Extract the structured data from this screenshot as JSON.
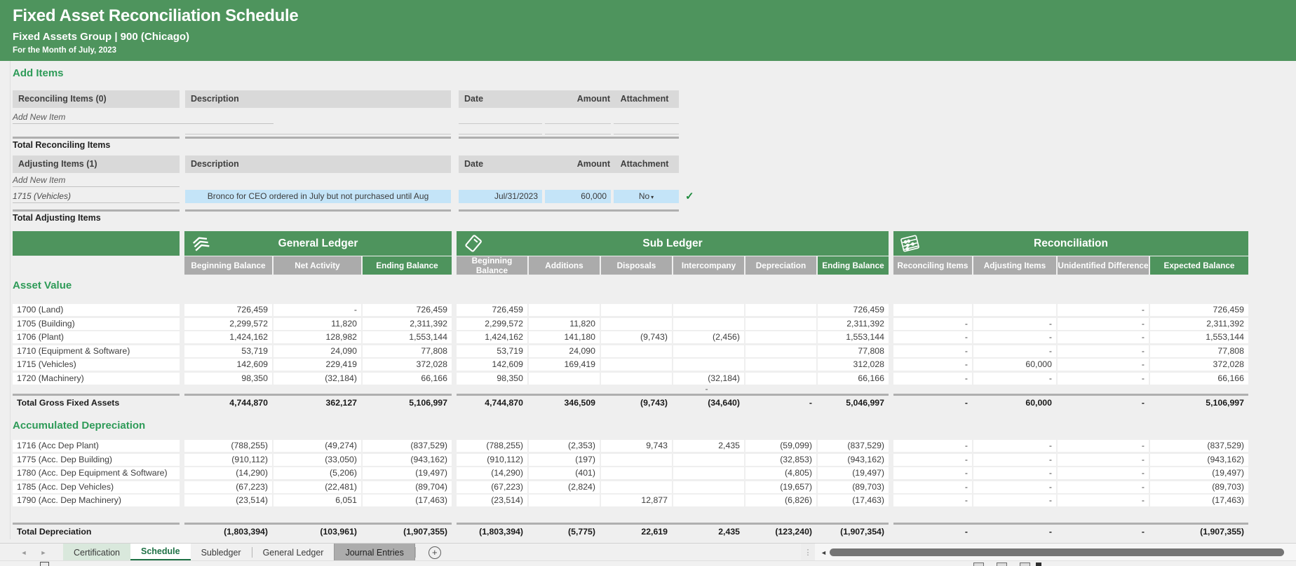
{
  "header": {
    "title": "Fixed Asset Reconciliation Schedule",
    "subtitle": "Fixed Assets Group  |  900 (Chicago)",
    "period": "For the Month of July, 2023"
  },
  "add_items": {
    "section_title": "Add Items",
    "reconciling": {
      "header": "Reconciling Items (0)",
      "description_header": "Description",
      "date_header": "Date",
      "amount_header": "Amount",
      "attachment_header": "Attachment",
      "add_new_label": "Add New Item",
      "total_label": "Total Reconciling Items",
      "rows": []
    },
    "adjusting": {
      "header": "Adjusting Items (1)",
      "description_header": "Description",
      "date_header": "Date",
      "amount_header": "Amount",
      "attachment_header": "Attachment",
      "add_new_label": "Add New Item",
      "total_label": "Total Adjusting Items",
      "rows": [
        {
          "account": "1715 (Vehicles)",
          "description": "Bronco for CEO ordered in July but not purchased until Aug",
          "date": "Jul/31/2023",
          "amount": "60,000",
          "attachment": "No",
          "validated": "✓"
        }
      ]
    }
  },
  "schedule": {
    "groups": [
      {
        "name": "General Ledger",
        "icon": "ledger-icon",
        "columns": [
          "Beginning Balance",
          "Net Activity",
          "Ending Balance"
        ]
      },
      {
        "name": "Sub Ledger",
        "icon": "subledger-icon",
        "columns": [
          "Beginning Balance",
          "Additions",
          "Disposals",
          "Intercompany",
          "Depreciation",
          "Ending Balance"
        ]
      },
      {
        "name": "Reconciliation",
        "icon": "reconciliation-icon",
        "columns": [
          "Reconciling Items",
          "Adjusting Items",
          "Unidentified Difference",
          "Expected Balance"
        ]
      }
    ],
    "asset_value": {
      "section_title": "Asset Value",
      "rows": [
        {
          "account": "1700 (Land)",
          "gl": [
            "726,459",
            "-",
            "726,459"
          ],
          "sl": [
            "726,459",
            "",
            "",
            "",
            "",
            "726,459"
          ],
          "rec": [
            "",
            "",
            "-",
            "726,459"
          ]
        },
        {
          "account": "1705 (Building)",
          "gl": [
            "2,299,572",
            "11,820",
            "2,311,392"
          ],
          "sl": [
            "2,299,572",
            "11,820",
            "",
            "",
            "",
            "2,311,392"
          ],
          "rec": [
            "-",
            "-",
            "-",
            "2,311,392"
          ]
        },
        {
          "account": "1706 (Plant)",
          "gl": [
            "1,424,162",
            "128,982",
            "1,553,144"
          ],
          "sl": [
            "1,424,162",
            "141,180",
            "(9,743)",
            "(2,456)",
            "",
            "1,553,144"
          ],
          "rec": [
            "-",
            "-",
            "-",
            "1,553,144"
          ]
        },
        {
          "account": "1710 (Equipment & Software)",
          "gl": [
            "53,719",
            "24,090",
            "77,808"
          ],
          "sl": [
            "53,719",
            "24,090",
            "",
            "",
            "",
            "77,808"
          ],
          "rec": [
            "-",
            "-",
            "-",
            "77,808"
          ]
        },
        {
          "account": "1715 (Vehicles)",
          "gl": [
            "142,609",
            "229,419",
            "372,028"
          ],
          "sl": [
            "142,609",
            "169,419",
            "",
            "",
            "",
            "312,028"
          ],
          "rec": [
            "-",
            "60,000",
            "-",
            "372,028"
          ]
        },
        {
          "account": "1720 (Machinery)",
          "gl": [
            "98,350",
            "(32,184)",
            "66,166"
          ],
          "sl": [
            "98,350",
            "",
            "",
            "(32,184)",
            "",
            "66,166"
          ],
          "rec": [
            "-",
            "-",
            "-",
            "66,166"
          ]
        }
      ],
      "spacer": {
        "sl": [
          "",
          "",
          "",
          "-",
          "",
          ""
        ]
      },
      "total": {
        "label": "Total Gross Fixed Assets",
        "gl": [
          "4,744,870",
          "362,127",
          "5,106,997"
        ],
        "sl": [
          "4,744,870",
          "346,509",
          "(9,743)",
          "(34,640)",
          "-",
          "5,046,997"
        ],
        "rec": [
          "-",
          "60,000",
          "-",
          "5,106,997"
        ]
      }
    },
    "accumulated_depreciation": {
      "section_title": "Accumulated Depreciation",
      "rows": [
        {
          "account": "1716 (Acc Dep Plant)",
          "gl": [
            "(788,255)",
            "(49,274)",
            "(837,529)"
          ],
          "sl": [
            "(788,255)",
            "(2,353)",
            "9,743",
            "2,435",
            "(59,099)",
            "(837,529)"
          ],
          "rec": [
            "-",
            "-",
            "-",
            "(837,529)"
          ]
        },
        {
          "account": "1775 (Acc. Dep Building)",
          "gl": [
            "(910,112)",
            "(33,050)",
            "(943,162)"
          ],
          "sl": [
            "(910,112)",
            "(197)",
            "",
            "",
            "(32,853)",
            "(943,162)"
          ],
          "rec": [
            "-",
            "-",
            "-",
            "(943,162)"
          ]
        },
        {
          "account": "1780 (Acc. Dep Equipment & Software)",
          "gl": [
            "(14,290)",
            "(5,206)",
            "(19,497)"
          ],
          "sl": [
            "(14,290)",
            "(401)",
            "",
            "",
            "(4,805)",
            "(19,497)"
          ],
          "rec": [
            "-",
            "-",
            "-",
            "(19,497)"
          ]
        },
        {
          "account": "1785 (Acc. Dep Vehicles)",
          "gl": [
            "(67,223)",
            "(22,481)",
            "(89,704)"
          ],
          "sl": [
            "(67,223)",
            "(2,824)",
            "",
            "",
            "(19,657)",
            "(89,703)"
          ],
          "rec": [
            "-",
            "-",
            "-",
            "(89,703)"
          ]
        },
        {
          "account": "1790 (Acc. Dep Machinery)",
          "gl": [
            "(23,514)",
            "6,051",
            "(17,463)"
          ],
          "sl": [
            "(23,514)",
            "",
            "12,877",
            "",
            "(6,826)",
            "(17,463)"
          ],
          "rec": [
            "-",
            "-",
            "-",
            "(17,463)"
          ]
        }
      ],
      "total": {
        "label": "Total Depreciation",
        "gl": [
          "(1,803,394)",
          "(103,961)",
          "(1,907,355)"
        ],
        "sl": [
          "(1,803,394)",
          "(5,775)",
          "22,619",
          "2,435",
          "(123,240)",
          "(1,907,354)"
        ],
        "rec": [
          "-",
          "-",
          "-",
          "(1,907,355)"
        ]
      }
    }
  },
  "tabs": {
    "items": [
      {
        "label": "Certification",
        "state": "green-tint"
      },
      {
        "label": "Schedule",
        "state": "active"
      },
      {
        "label": "Subledger",
        "state": "normal"
      },
      {
        "label": "General Ledger",
        "state": "normal"
      },
      {
        "label": "Journal Entries",
        "state": "gray"
      }
    ],
    "add_sheet_label": "+"
  },
  "colors": {
    "banner_green": "#4E945D",
    "heading_green": "#2E9B58",
    "active_tab_green": "#1E7145",
    "subheader_gray": "#ABABAB",
    "header_gray": "#D9D9D9",
    "highlight_blue": "#C4E4F8",
    "check_green": "#1D8A3C"
  }
}
